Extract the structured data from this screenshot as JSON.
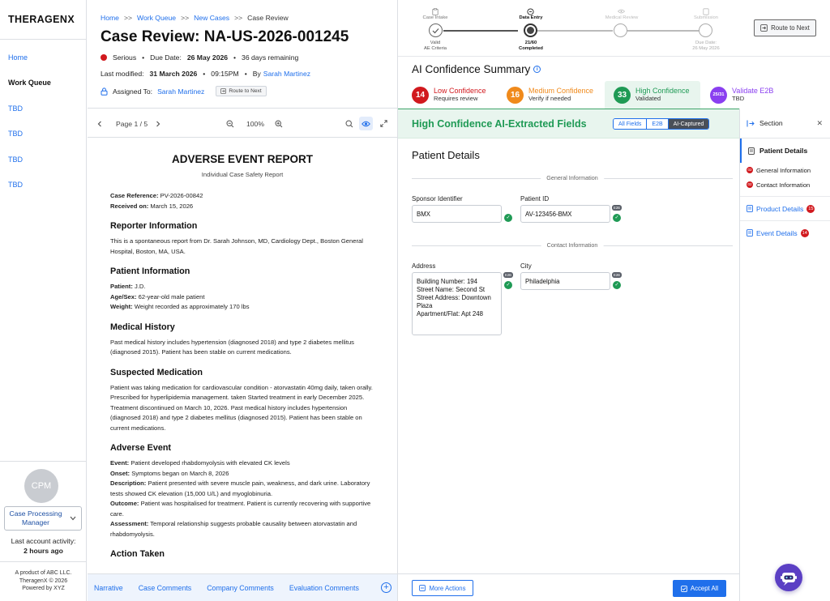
{
  "brand": "THERAGENX",
  "sidebar": {
    "nav": [
      {
        "label": "Home",
        "active": false
      },
      {
        "label": "Work Queue",
        "active": true
      },
      {
        "label": "TBD",
        "active": false
      },
      {
        "label": "TBD",
        "active": false
      },
      {
        "label": "TBD",
        "active": false
      },
      {
        "label": "TBD",
        "active": false
      }
    ],
    "avatar_initials": "CPM",
    "role": "Case Processing Manager",
    "last_activity_label": "Last account activity:",
    "last_activity_value": "2 hours ago",
    "footer": [
      "A product of ABC LLC.",
      "TheragenX © 2026",
      "Powered by XYZ"
    ]
  },
  "breadcrumb": {
    "items": [
      "Home",
      "Work Queue",
      "New Cases",
      "Case Review"
    ],
    "separator": ">>"
  },
  "case": {
    "title": "Case Review: NA-US-2026-001245",
    "severity": "Serious",
    "severity_color": "#d1191e",
    "due_date_label": "Due Date:",
    "due_date": "26 May 2026",
    "remaining": "36 days remaining",
    "last_modified_label": "Last modified:",
    "last_modified_date": "31 March 2026",
    "last_modified_time": "09:15PM",
    "by_label": "By",
    "modified_by": "Sarah Martinez",
    "assigned_label": "Assigned To:",
    "assigned_to": "Sarah Martinez",
    "route_label": "Route to Next"
  },
  "viewer": {
    "page_label": "Page 1 / 5",
    "zoom": "100%"
  },
  "document": {
    "title": "ADVERSE EVENT REPORT",
    "subtitle": "Individual Case Safety Report",
    "case_ref_label": "Case Reference:",
    "case_ref": "PV-2026-00842",
    "received_label": "Received on:",
    "received": "March 15, 2026",
    "reporter_h": "Reporter Information",
    "reporter_text": "This is a spontaneous report from Dr. Sarah Johnson, MD, Cardiology Dept., Boston General Hospital, Boston, MA, USA.",
    "patient_h": "Patient Information",
    "patient_label": "Patient:",
    "patient": "J.D.",
    "agesex_label": "Age/Sex:",
    "agesex": "62-year-old male patient",
    "weight_label": "Weight:",
    "weight": "Weight recorded as approximately 170 lbs",
    "history_h": "Medical History",
    "history_text": "Past medical history includes hypertension (diagnosed 2018) and type 2 diabetes mellitus (diagnosed 2015). Patient has been stable on current medications.",
    "med_h": "Suspected Medication",
    "med_text": "Patient was taking medication for cardiovascular condition - atorvastatin 40mg daily, taken orally. Prescribed for hyperlipidemia management. taken Started treatment in early December 2025. Treatment discontinued on March 10, 2026. Past medical history includes hypertension (diagnosed 2018) and type 2 diabetes mellitus (diagnosed 2015). Patient has been stable on current medications.",
    "ae_h": "Adverse Event",
    "event_label": "Event:",
    "event": "Patient developed rhabdomyolysis with elevated CK levels",
    "onset_label": "Onset:",
    "onset": "Symptoms began on March 8, 2026",
    "desc_label": "Description:",
    "desc": "Patient presented with severe muscle pain, weakness, and dark urine. Laboratory tests showed CK elevation (15,000 U/L) and myoglobinuria.",
    "outcome_label": "Outcome:",
    "outcome": "Patient was hospitalised for treatment. Patient is currently recovering with supportive care.",
    "assess_label": "Assessment:",
    "assess": "Temporal relationship suggests probable causality between atorvastatin and rhabdomyolysis.",
    "action_h": "Action Taken"
  },
  "doc_tabs": [
    "Narrative",
    "Case Comments",
    "Company Comments",
    "Evaluation Comments"
  ],
  "stepper": {
    "steps": [
      {
        "label": "Case Intake",
        "sub1": "Valid",
        "sub2": "AE Criteria",
        "state": "done"
      },
      {
        "label": "Data Entry",
        "sub1": "21/60",
        "sub2": "Completed",
        "state": "current"
      },
      {
        "label": "Medical Review",
        "sub1": "",
        "sub2": "",
        "state": "pending"
      },
      {
        "label": "Submission",
        "sub1": "Due Date:",
        "sub2": "26 May 2026",
        "state": "pending"
      }
    ],
    "route_label": "Route to Next"
  },
  "ai_summary": {
    "title": "AI Confidence Summary",
    "cards": [
      {
        "count": "14",
        "label": "Low Confidence",
        "sub": "Requires review",
        "color": "#d1191e"
      },
      {
        "count": "16",
        "label": "Medium Confidence",
        "sub": "Verify if needed",
        "color": "#f08a1c"
      },
      {
        "count": "33",
        "label": "High Confidence",
        "sub": "Validated",
        "color": "#1f9a55"
      },
      {
        "count": "25/31",
        "label": "Validate E2B",
        "sub": "TBD",
        "color": "#8a3ff0"
      }
    ]
  },
  "high_conf": {
    "title": "High Confidence AI-Extracted Fields",
    "filters": [
      "All Fields",
      "E2B",
      "AI-Captured"
    ]
  },
  "patient_details": {
    "title": "Patient Details",
    "general_header": "General Information",
    "contact_header": "Contact Information",
    "sponsor_label": "Sponsor Identifier",
    "sponsor_value": "BMX",
    "patient_id_label": "Patient ID",
    "patient_id_value": "AV-123456-BMX",
    "address_label": "Address",
    "address_lines": [
      "Building Number: 194",
      "Street Name: Second St",
      "Street Address: Downtown",
      "Plaza",
      "Apartment/Flat: Apt 248"
    ],
    "city_label": "City",
    "city_value": "Philadelphia",
    "e2b_tag": "E2B"
  },
  "actions": {
    "more": "More Actions",
    "accept": "Accept All"
  },
  "section_panel": {
    "title": "Section",
    "active_item": "Patient Details",
    "subitems": [
      {
        "label": "General Information",
        "count": "02"
      },
      {
        "label": "Contact Information",
        "count": "02"
      }
    ],
    "links": [
      {
        "label": "Product Details",
        "count": "15"
      },
      {
        "label": "Event Details",
        "count": "14"
      }
    ]
  }
}
